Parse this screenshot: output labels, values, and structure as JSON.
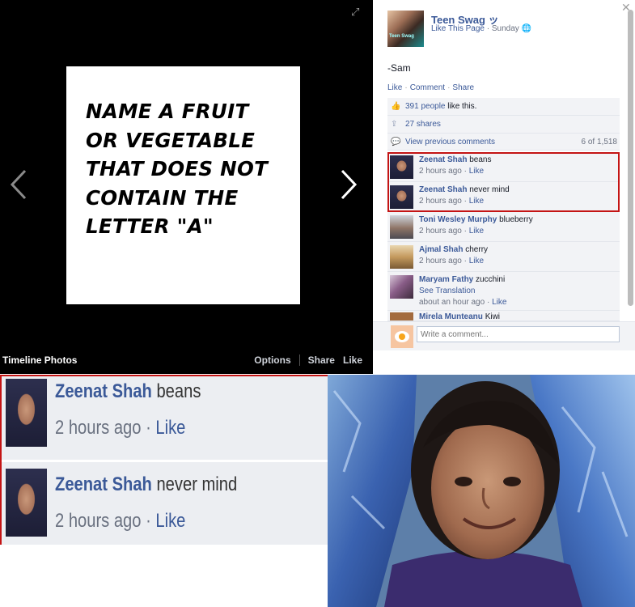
{
  "viewer": {
    "photo_text_lines": [
      "NAME A FRUIT",
      "OR VEGETABLE",
      "THAT DOES NOT",
      "CONTAIN THE",
      "LETTER \"A\""
    ],
    "album_title": "Timeline Photos",
    "actions": {
      "options": "Options",
      "share": "Share",
      "like": "Like"
    }
  },
  "post": {
    "page_name": "Teen Swag ッ",
    "avatar_caption": "Teen Swag",
    "like_page": "Like This Page",
    "time": "Sunday",
    "text": "-Sam",
    "actions": {
      "like": "Like",
      "comment": "Comment",
      "share": "Share"
    },
    "likes_count": "391 people",
    "likes_suffix": " like this.",
    "shares": "27 shares",
    "view_previous": "View previous comments",
    "comment_range": "6 of 1,518"
  },
  "comments": [
    {
      "name": "Zeenat Shah",
      "text": "beans",
      "time": "2 hours ago",
      "like": "Like",
      "avatar": "zeenat-avatar"
    },
    {
      "name": "Zeenat Shah",
      "text": "never mind",
      "time": "2 hours ago",
      "like": "Like",
      "avatar": "zeenat-avatar"
    },
    {
      "name": "Toni Wesley Murphy",
      "text": "blueberry",
      "time": "2 hours ago",
      "like": "Like",
      "avatar": "toni-avatar"
    },
    {
      "name": "Ajmal Shah",
      "text": "cherry",
      "time": "2 hours ago",
      "like": "Like",
      "avatar": "ajmal-avatar"
    },
    {
      "name": "Maryam Fathy",
      "text": "zucchini",
      "see_translation": "See Translation",
      "time": "about an hour ago",
      "like": "Like",
      "avatar": "maryam-avatar"
    },
    {
      "name": "Mirela Munteanu",
      "text": "Kiwi"
    }
  ],
  "compose": {
    "placeholder": "Write a comment..."
  },
  "zoom": [
    {
      "name": "Zeenat Shah",
      "text": "beans",
      "time": "2 hours ago",
      "like": "Like"
    },
    {
      "name": "Zeenat Shah",
      "text": "never mind",
      "time": "2 hours ago",
      "like": "Like"
    }
  ],
  "icons": {
    "expand": "expand-icon",
    "prev": "chevron-left-icon",
    "next": "chevron-right-icon",
    "close": "close-icon",
    "like": "thumbs-up-icon",
    "share": "share-icon",
    "comment": "comment-icon",
    "globe": "globe-icon"
  },
  "colors": {
    "link": "#3b5998",
    "highlight": "#c41414",
    "panel_bg": "#f2f3f6",
    "viewer_bg": "#000000"
  }
}
